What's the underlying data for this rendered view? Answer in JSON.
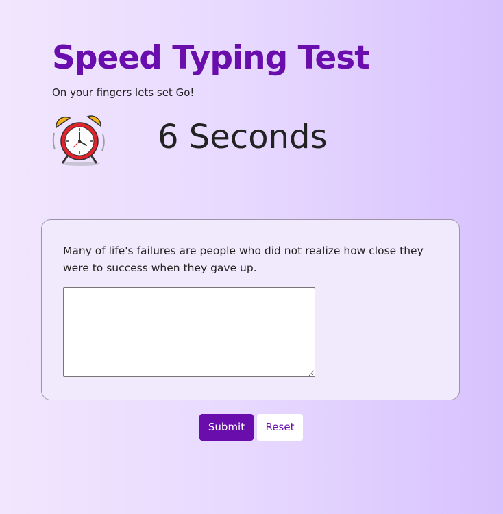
{
  "header": {
    "title": "Speed Typing Test",
    "subtitle": "On your fingers lets set Go!"
  },
  "timer": {
    "icon": "alarm-clock-icon",
    "text": "6 Seconds"
  },
  "test": {
    "quote": "Many of life's failures are people who did not realize how close they were to success when they gave up.",
    "answer_value": ""
  },
  "actions": {
    "submit_label": "Submit",
    "reset_label": "Reset"
  },
  "colors": {
    "accent": "#6a0dad",
    "background_start": "#f1e6fd",
    "background_end": "#d8c2fd",
    "card_background": "#f1eafd"
  }
}
